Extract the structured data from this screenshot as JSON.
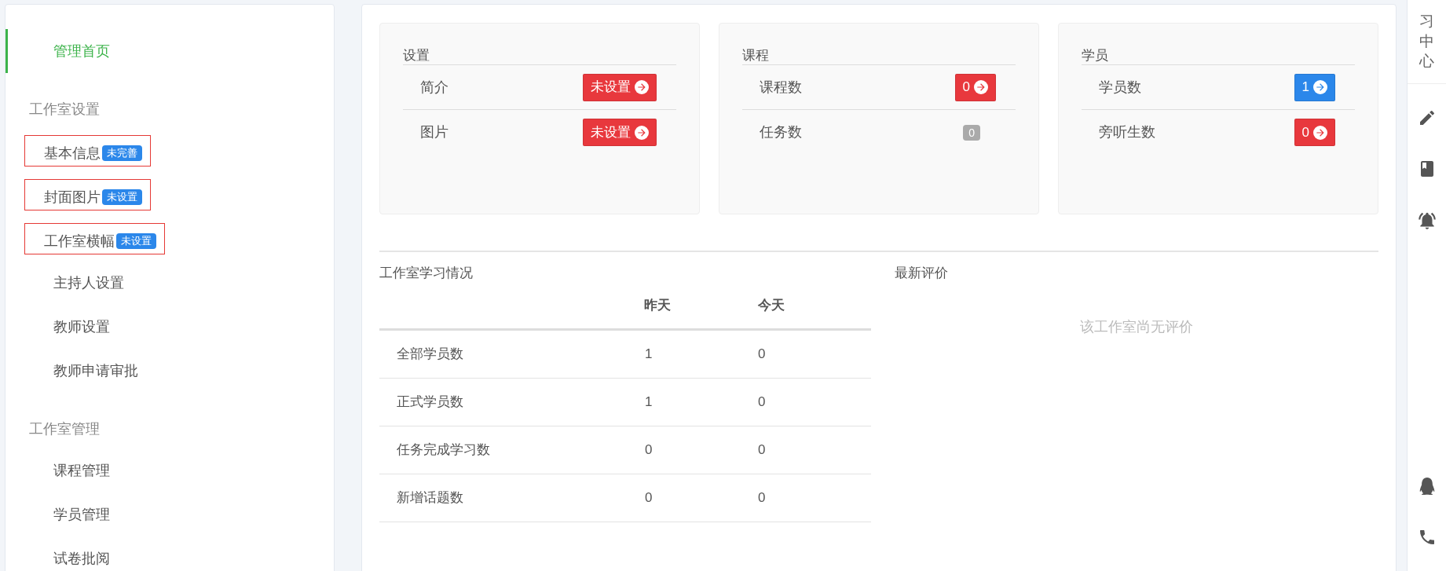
{
  "sidebar": {
    "home": {
      "label": "管理首页",
      "selected": true
    },
    "sections": [
      {
        "title": "工作室设置",
        "items": [
          {
            "label": "基本信息",
            "badge": "未完善",
            "highlighted": true,
            "selected": false
          },
          {
            "label": "封面图片",
            "badge": "未设置",
            "highlighted": true,
            "selected": false
          },
          {
            "label": "工作室横幅",
            "badge": "未设置",
            "highlighted": true,
            "selected": false
          },
          {
            "label": "主持人设置",
            "highlighted": false,
            "selected": false
          },
          {
            "label": "教师设置",
            "highlighted": false,
            "selected": false
          },
          {
            "label": "教师申请审批",
            "highlighted": false,
            "selected": false
          }
        ]
      },
      {
        "title": "工作室管理",
        "items": [
          {
            "label": "课程管理",
            "highlighted": false,
            "selected": false
          },
          {
            "label": "学员管理",
            "highlighted": false,
            "selected": false
          },
          {
            "label": "试卷批阅",
            "highlighted": false,
            "selected": false
          }
        ]
      }
    ]
  },
  "cards": [
    {
      "title": "设置",
      "rows": [
        {
          "label": "简介",
          "action": {
            "kind": "link-button",
            "text": "未设置",
            "color": "#e8383d"
          }
        },
        {
          "label": "图片",
          "action": {
            "kind": "link-button",
            "text": "未设置",
            "color": "#e8383d"
          }
        }
      ]
    },
    {
      "title": "课程",
      "rows": [
        {
          "label": "课程数",
          "action": {
            "kind": "link-button",
            "text": "0",
            "color": "#e8383d"
          }
        },
        {
          "label": "任务数",
          "action": {
            "kind": "plain-badge",
            "text": "0",
            "color": "#aaaaaa"
          }
        }
      ]
    },
    {
      "title": "学员",
      "rows": [
        {
          "label": "学员数",
          "action": {
            "kind": "link-button",
            "text": "1",
            "color": "#2b87ea"
          }
        },
        {
          "label": "旁听生数",
          "action": {
            "kind": "link-button",
            "text": "0",
            "color": "#e8383d"
          }
        }
      ]
    }
  ],
  "study": {
    "title": "工作室学习情况",
    "columns": [
      "昨天",
      "今天"
    ],
    "rows": [
      {
        "label": "全部学员数",
        "values": [
          "1",
          "0"
        ]
      },
      {
        "label": "正式学员数",
        "values": [
          "1",
          "0"
        ]
      },
      {
        "label": "任务完成学习数",
        "values": [
          "0",
          "0"
        ]
      },
      {
        "label": "新增话题数",
        "values": [
          "0",
          "0"
        ]
      }
    ]
  },
  "reviews": {
    "title": "最新评价",
    "empty_text": "该工作室尚无评价"
  },
  "right_bar": {
    "title": "习中心"
  }
}
